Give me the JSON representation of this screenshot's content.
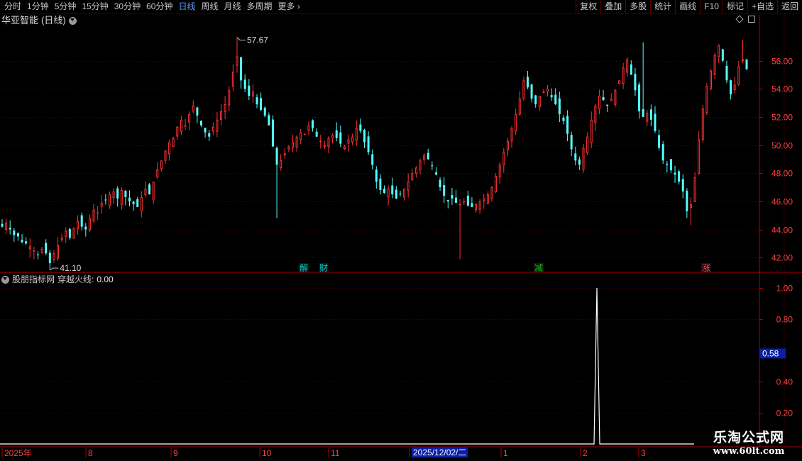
{
  "toolbar": {
    "periods": [
      "分时",
      "1分钟",
      "5分钟",
      "15分钟",
      "30分钟",
      "60分钟",
      "日线",
      "周线",
      "月线",
      "多周期",
      "更多"
    ],
    "active_period": "日线",
    "actions": [
      "复权",
      "叠加",
      "多股",
      "统计",
      "画线",
      "F10",
      "标记",
      "+自选",
      "返回"
    ]
  },
  "main_panel": {
    "stock_name": "华亚智能",
    "period_label": "(日线)",
    "high_marker": "57.67",
    "low_marker": "41.10",
    "event_markers": [
      {
        "text": "解",
        "color": "#00c8c8"
      },
      {
        "text": "财",
        "color": "#00c8c8"
      },
      {
        "text": "减",
        "color": "#00c800"
      },
      {
        "text": "涨",
        "color": "#ff3c3c"
      }
    ]
  },
  "indicator_panel": {
    "name": "股朋指标网",
    "line_label": "穿越火线:",
    "line_value": "0.00",
    "cursor_value": "0.58"
  },
  "date_axis": {
    "labels": [
      "2025年",
      "8",
      "9",
      "10",
      "11",
      "1",
      "2",
      "3"
    ],
    "highlight": "2025/12/02/二"
  },
  "watermark": {
    "line1": "乐淘公式网",
    "line2": "www.60lt.com"
  },
  "chart_data": [
    {
      "type": "candlestick",
      "title": "华亚智能(日线)",
      "ylim": [
        41.0,
        58.5
      ],
      "yticks": [
        "56.00",
        "54.00",
        "52.00",
        "50.00",
        "48.00",
        "46.00",
        "44.00",
        "42.00"
      ],
      "up_color": "#ff3232",
      "down_color": "#54ffff",
      "grid": true,
      "closes": [
        44.2,
        44.5,
        44.0,
        43.6,
        43.5,
        43.1,
        43.0,
        42.8,
        42.5,
        42.2,
        42.6,
        42.3,
        41.6,
        42.3,
        42.9,
        43.4,
        43.9,
        43.4,
        44.1,
        44.6,
        44.2,
        44.0,
        44.8,
        45.4,
        45.2,
        45.9,
        46.1,
        46.5,
        46.7,
        46.2,
        46.8,
        46.3,
        46.0,
        45.8,
        45.6,
        46.3,
        46.9,
        46.5,
        47.4,
        48.3,
        48.9,
        49.6,
        50.2,
        50.5,
        51.3,
        51.8,
        51.4,
        52.2,
        52.8,
        52.1,
        51.4,
        50.9,
        50.6,
        51.3,
        51.8,
        52.4,
        52.9,
        53.9,
        55.2,
        56.3,
        54.6,
        54.0,
        53.5,
        53.8,
        52.9,
        52.5,
        52.1,
        51.4,
        49.9,
        48.6,
        48.9,
        49.4,
        49.9,
        50.2,
        50.6,
        50.9,
        50.8,
        51.4,
        51.2,
        50.6,
        50.3,
        50.0,
        50.5,
        50.7,
        50.5,
        50.1,
        49.9,
        50.4,
        50.6,
        51.2,
        51.0,
        50.2,
        49.5,
        48.6,
        47.4,
        46.8,
        46.6,
        46.9,
        46.5,
        46.2,
        46.5,
        46.9,
        47.4,
        48.0,
        48.4,
        48.9,
        49.3,
        49.0,
        48.5,
        47.9,
        47.0,
        46.4,
        46.0,
        46.2,
        45.9,
        45.8,
        46.0,
        45.7,
        45.6,
        45.8,
        46.0,
        46.2,
        46.5,
        47.0,
        47.8,
        48.6,
        49.5,
        50.3,
        51.2,
        52.2,
        53.3,
        54.6,
        54.1,
        53.3,
        52.9,
        53.5,
        53.8,
        54.0,
        53.4,
        52.9,
        52.2,
        51.7,
        50.8,
        49.7,
        48.9,
        48.6,
        49.8,
        50.6,
        51.8,
        52.8,
        53.5,
        53.2,
        52.8,
        53.3,
        53.9,
        54.6,
        55.5,
        56.1,
        55.0,
        53.9,
        52.4,
        52.0,
        52.3,
        51.8,
        51.0,
        49.8,
        48.9,
        48.6,
        48.2,
        47.9,
        47.4,
        46.7,
        45.3,
        45.8,
        47.7,
        50.4,
        52.6,
        54.2,
        55.3,
        56.4,
        57.1,
        56.0,
        54.6,
        53.6,
        54.3,
        55.6,
        56.1,
        55.4
      ]
    },
    {
      "type": "line",
      "title": "股朋指标网 穿越火线",
      "series": [
        {
          "name": "穿越火线",
          "values": [
            0,
            0,
            0,
            0,
            1,
            0,
            0,
            0
          ]
        }
      ],
      "ylim": [
        0,
        1.05
      ],
      "yticks": [
        "1.00",
        "0.80",
        "0.40",
        "0.20"
      ]
    }
  ]
}
